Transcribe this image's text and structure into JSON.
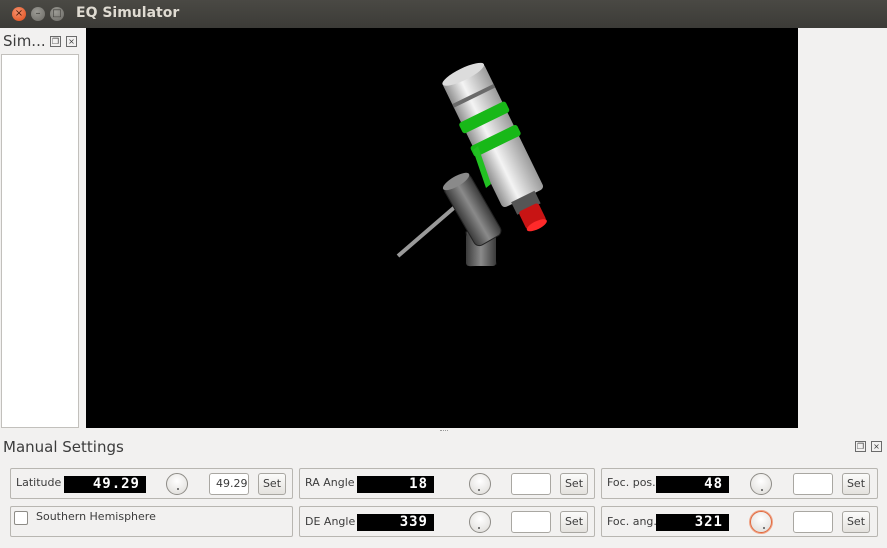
{
  "window": {
    "title": "EQ Simulator"
  },
  "dock_left": {
    "title": "Sim..."
  },
  "manual": {
    "title": "Manual Settings",
    "latitude": {
      "label": "Latitude",
      "display": "49.29",
      "value": "49.29",
      "set_label": "Set"
    },
    "southern": {
      "label": "Southern Hemisphere",
      "checked": false
    },
    "ra": {
      "label": "RA Angle",
      "display": "18",
      "value": "",
      "set_label": "Set"
    },
    "de": {
      "label": "DE Angle",
      "display": "339",
      "value": "",
      "set_label": "Set"
    },
    "foc_pos": {
      "label": "Foc. pos.",
      "display": "48",
      "value": "",
      "set_label": "Set"
    },
    "foc_ang": {
      "label": "Foc. ang.",
      "display": "321",
      "value": "",
      "set_label": "Set"
    }
  }
}
